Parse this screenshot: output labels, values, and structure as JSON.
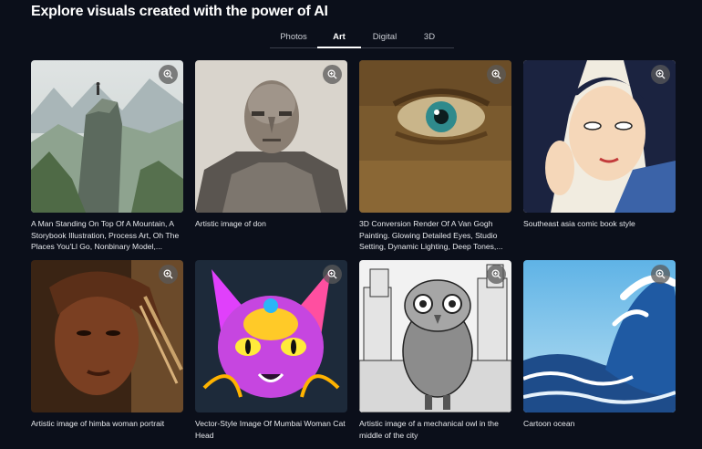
{
  "header": {
    "title": "Explore visuals created with the power of AI"
  },
  "tabs": [
    {
      "label": "Photos",
      "active": false
    },
    {
      "label": "Art",
      "active": true
    },
    {
      "label": "Digital",
      "active": false
    },
    {
      "label": "3D",
      "active": false
    }
  ],
  "gallery": {
    "items": [
      {
        "caption": "A Man Standing On Top Of A Mountain, A Storybook Illustration, Process Art, Oh The Places You'Ll Go, Nonbinary Model,...",
        "zoom_icon": "zoom-in-icon"
      },
      {
        "caption": "Artistic image of don",
        "zoom_icon": "zoom-in-icon"
      },
      {
        "caption": "3D Conversion Render Of A Van Gogh Painting. Glowing Detailed Eyes, Studio Setting, Dynamic Lighting, Deep Tones,...",
        "zoom_icon": "zoom-in-icon"
      },
      {
        "caption": "Southeast asia comic book style",
        "zoom_icon": "zoom-in-icon"
      },
      {
        "caption": "Artistic image of himba woman portrait",
        "zoom_icon": "zoom-in-icon"
      },
      {
        "caption": "Vector-Style Image Of Mumbai Woman Cat Head",
        "zoom_icon": "zoom-in-icon"
      },
      {
        "caption": "Artistic image of a mechanical owl in the middle of the city",
        "zoom_icon": "zoom-in-icon"
      },
      {
        "caption": "Cartoon ocean",
        "zoom_icon": "zoom-in-icon"
      }
    ]
  },
  "colors": {
    "background": "#0b0f1a",
    "text": "#ffffff",
    "tab_inactive": "#c9ccd3"
  }
}
